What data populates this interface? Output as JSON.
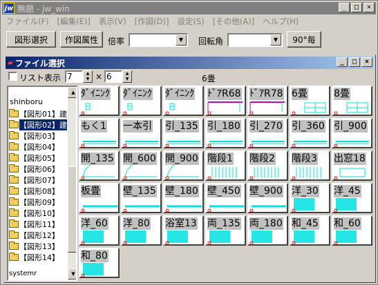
{
  "app": {
    "title": "無題 - jw_win",
    "logo": "jw"
  },
  "title_buttons": [
    "_",
    "□",
    "×"
  ],
  "menu": [
    "ファイル(F)",
    "[編集(E)]",
    "表示(V)",
    "[作図(D)]",
    "設定(S)",
    "[その他(A)]",
    "ヘルプ(H)"
  ],
  "toolbar": {
    "shape_select": "図形選択",
    "draw_attr": "作図属性",
    "scale_label": "倍率",
    "scale_value": "",
    "rotation_label": "回転角",
    "rotation_value": "",
    "rot90": "90°毎"
  },
  "child": {
    "title": "ファイル選択",
    "list_label": "リスト表示",
    "cols": "7",
    "times": "×",
    "rows": "6",
    "heading": "6畳"
  },
  "tree": {
    "root": "shinboru",
    "items": [
      "【図形01】建",
      "【図形02】建",
      "【図形03】",
      "【図形04】",
      "【図形05】",
      "【図形06】",
      "【図形07】",
      "【図形08】",
      "【図形09】",
      "【図形10】",
      "【図形11】",
      "【図形12】",
      "【図形13】",
      "【図形14】"
    ],
    "selected": 1,
    "bottom": "systemr"
  },
  "files": [
    "ﾀﾞｲﾆﾝｸ",
    "ﾀﾞｲﾆﾝｸ",
    "ﾀﾞｲﾆﾝｸ",
    "ﾄﾞｱR68",
    "ﾄﾞｱR78",
    "6畳",
    "8畳",
    "もく1",
    "一本引",
    "引_135",
    "引_180",
    "引_270",
    "引_360",
    "引_900",
    "開_135",
    "開_600",
    "開_900",
    "階段1",
    "階段2",
    "階段3",
    "出窓18",
    "板畳",
    "壁_135",
    "壁_180",
    "壁_450",
    "壁_900",
    "洋_30",
    "洋_45",
    "洋_60",
    "洋_80",
    "浴室13",
    "両_135",
    "両_180",
    "和_45",
    "和_60",
    "和_80"
  ],
  "colors": {
    "line": "#00e0e0",
    "door": "#c000c0",
    "origin": "#ff0000",
    "selection": "#0a246a"
  },
  "icons": [
    "close-icon",
    "minimize-icon",
    "maximize-icon",
    "folder-icon",
    "arrow-up-icon",
    "arrow-down-icon",
    "dropdown-arrow-icon"
  ]
}
